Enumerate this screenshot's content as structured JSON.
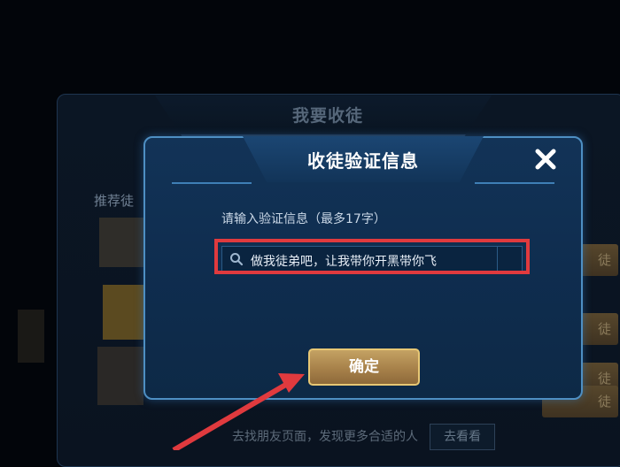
{
  "background": {
    "title": "我要收徒",
    "recommend_label": "推荐徒",
    "buttons": [
      "徒",
      "徒",
      "徒",
      "徒"
    ],
    "footer_text": "去找朋友页面，发现更多合适的人",
    "footer_button": "去看看"
  },
  "dialog": {
    "title": "收徒验证信息",
    "close_icon": "close-icon",
    "prompt": "请输入验证信息（最多17字）",
    "input": {
      "value": "做我徒弟吧，让我带你开黑带你飞",
      "icon": "search-icon"
    },
    "confirm_label": "确定"
  },
  "annotations": {
    "highlight_color": "#e03a3e",
    "arrow_color": "#e03a3e"
  }
}
